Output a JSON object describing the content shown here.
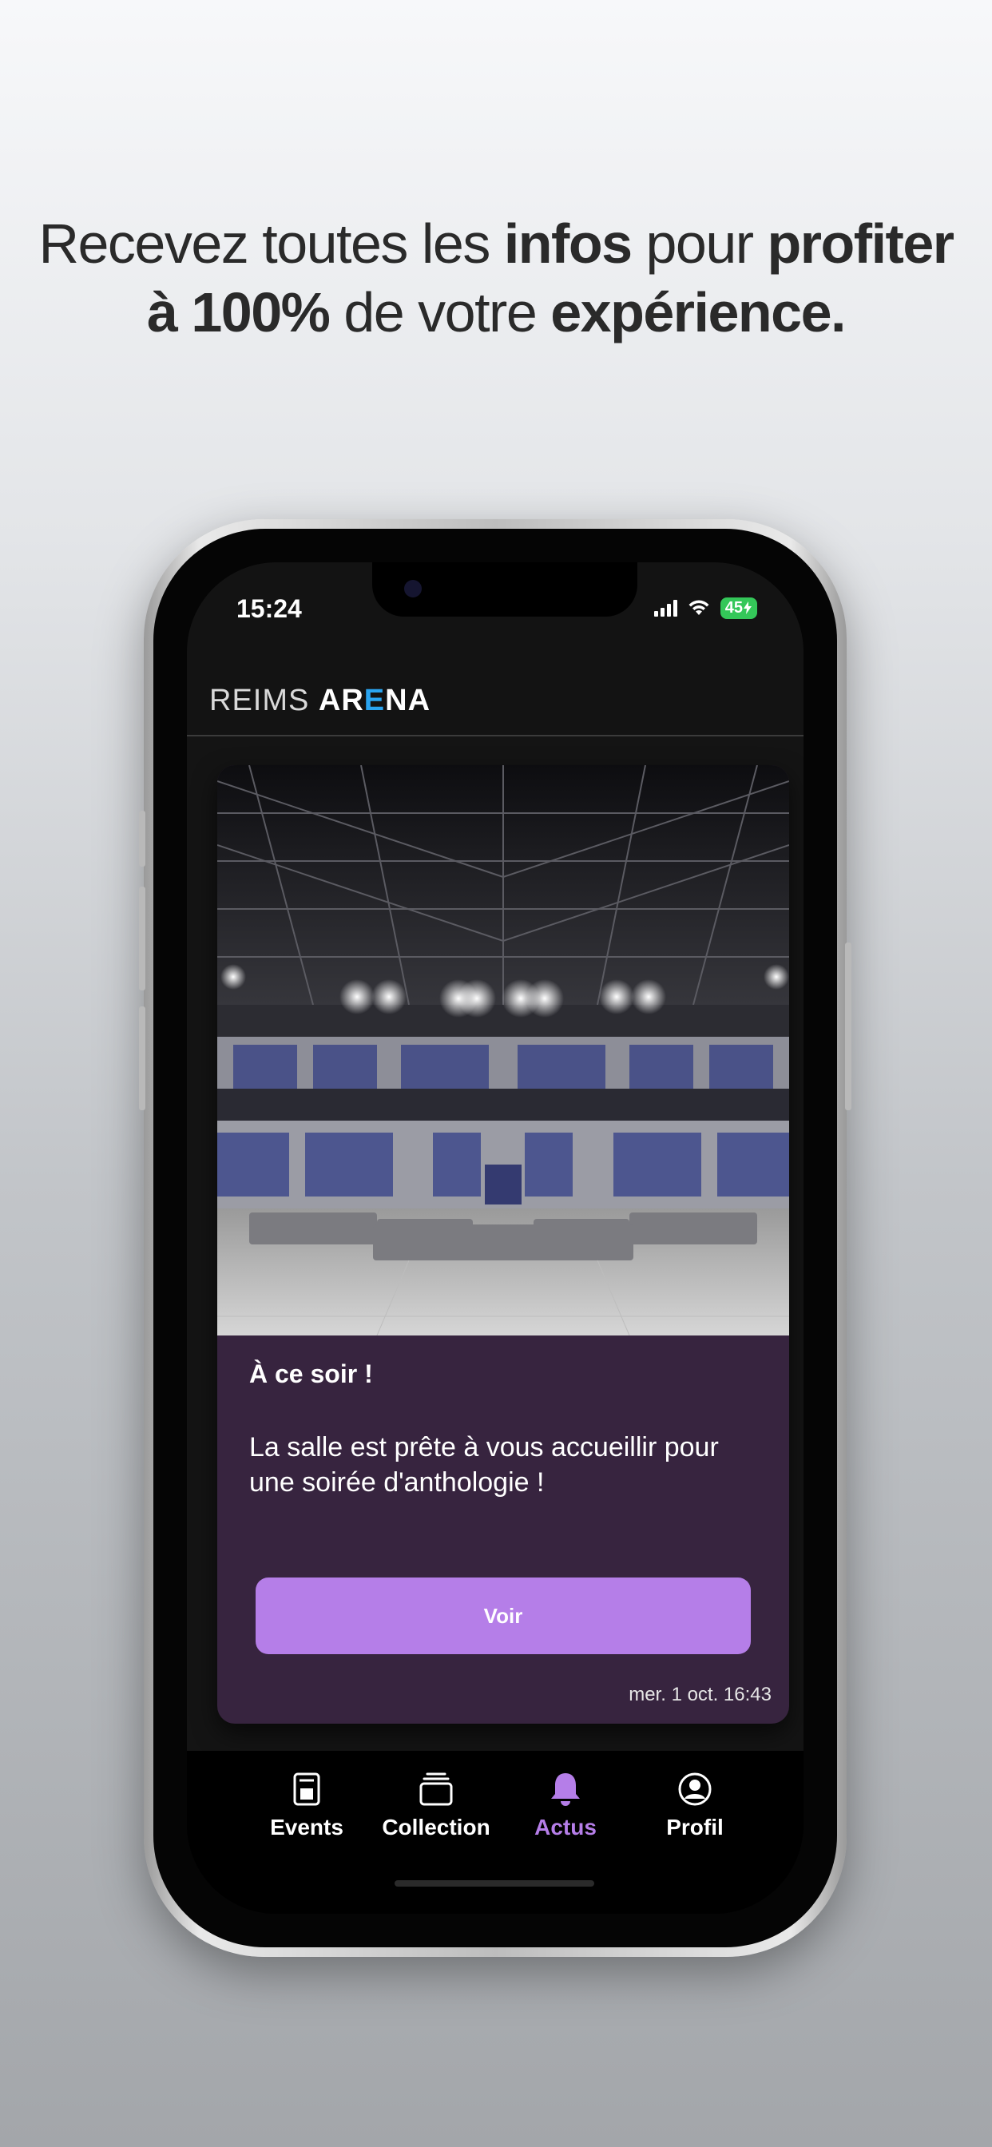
{
  "headline": {
    "l1a": "Recevez toutes les ",
    "l1b": "infos",
    "l1c": " pour ",
    "l1d": "profiter",
    "l2a": "à 100%",
    "l2b": " de votre ",
    "l2c": "expérience."
  },
  "status_bar": {
    "time": "15:24",
    "battery": "45"
  },
  "app": {
    "logo_part1": "REIMS ",
    "logo_part2a": "AR",
    "logo_part2b": "E",
    "logo_part2c": "NA"
  },
  "card": {
    "title": "À ce soir !",
    "body": "La salle est prête à vous accueillir pour une soirée d'anthologie !",
    "button": "Voir",
    "date": "mer. 1 oct. 16:43"
  },
  "tabs": [
    {
      "label": "Events",
      "icon": "ticket-icon",
      "active": false
    },
    {
      "label": "Collection",
      "icon": "collection-icon",
      "active": false
    },
    {
      "label": "Actus",
      "icon": "bell-icon",
      "active": true
    },
    {
      "label": "Profil",
      "icon": "profile-icon",
      "active": false
    }
  ],
  "colors": {
    "accent": "#b57ee8",
    "card_bg": "#37243f",
    "logo_accent": "#2aa4f0"
  }
}
